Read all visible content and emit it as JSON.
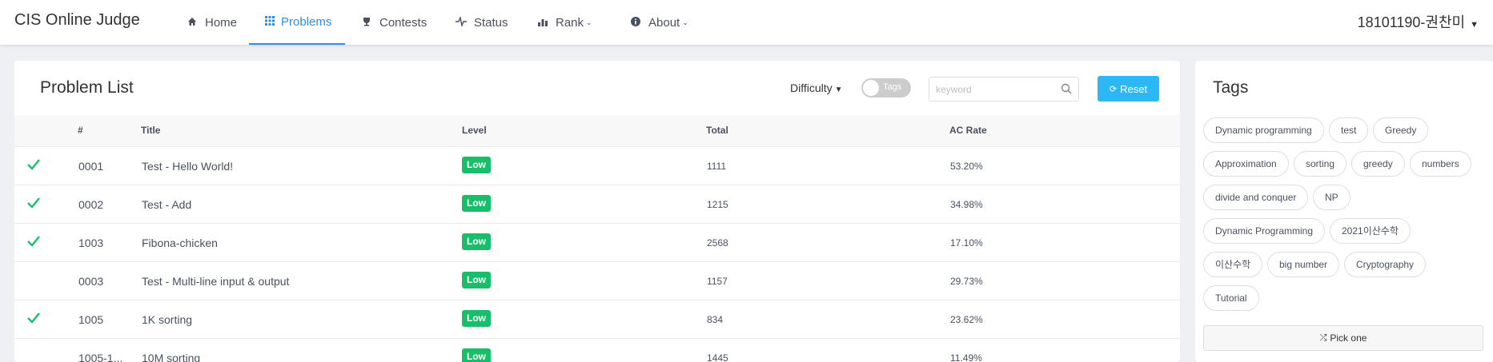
{
  "header": {
    "logo": "CIS Online Judge",
    "nav": [
      {
        "label": "Home",
        "icon": "home-icon"
      },
      {
        "label": "Problems",
        "icon": "grid-icon",
        "active": true
      },
      {
        "label": "Contests",
        "icon": "trophy-icon"
      },
      {
        "label": "Status",
        "icon": "pulse-icon"
      },
      {
        "label": "Rank",
        "icon": "bar-chart-icon",
        "dropdown": true
      },
      {
        "label": "About",
        "icon": "info-icon",
        "dropdown": true
      }
    ],
    "user": "18101190-권찬미"
  },
  "problem_list": {
    "title": "Problem List",
    "difficulty_label": "Difficulty",
    "tags_toggle_label": "Tags",
    "search_placeholder": "keyword",
    "reset_label": "Reset",
    "columns": [
      "#",
      "Title",
      "Level",
      "Total",
      "AC Rate"
    ],
    "rows": [
      {
        "solved": true,
        "id": "0001",
        "title": "Test - Hello World!",
        "level": "Low",
        "total": "1111",
        "ac_rate": "53.20%"
      },
      {
        "solved": true,
        "id": "0002",
        "title": "Test - Add",
        "level": "Low",
        "total": "1215",
        "ac_rate": "34.98%"
      },
      {
        "solved": true,
        "id": "1003",
        "title": "Fibona-chicken",
        "level": "Low",
        "total": "2568",
        "ac_rate": "17.10%"
      },
      {
        "solved": false,
        "id": "0003",
        "title": "Test - Multi-line input & output",
        "level": "Low",
        "total": "1157",
        "ac_rate": "29.73%"
      },
      {
        "solved": true,
        "id": "1005",
        "title": "1K sorting",
        "level": "Low",
        "total": "834",
        "ac_rate": "23.62%"
      },
      {
        "solved": false,
        "id": "1005-1...",
        "title": "10M sorting",
        "level": "Low",
        "total": "1445",
        "ac_rate": "11.49%"
      }
    ]
  },
  "tags": {
    "title": "Tags",
    "items": [
      "Dynamic programming",
      "test",
      "Greedy",
      "Approximation",
      "sorting",
      "greedy",
      "numbers",
      "divide and conquer",
      "NP",
      "Dynamic Programming",
      "2021이산수학",
      "이산수학",
      "big number",
      "Cryptography",
      "Tutorial"
    ],
    "pick_one_label": "Pick one"
  },
  "colors": {
    "accent": "#2d8cf0",
    "success": "#19be6b",
    "reset_button": "#2db7f5"
  }
}
